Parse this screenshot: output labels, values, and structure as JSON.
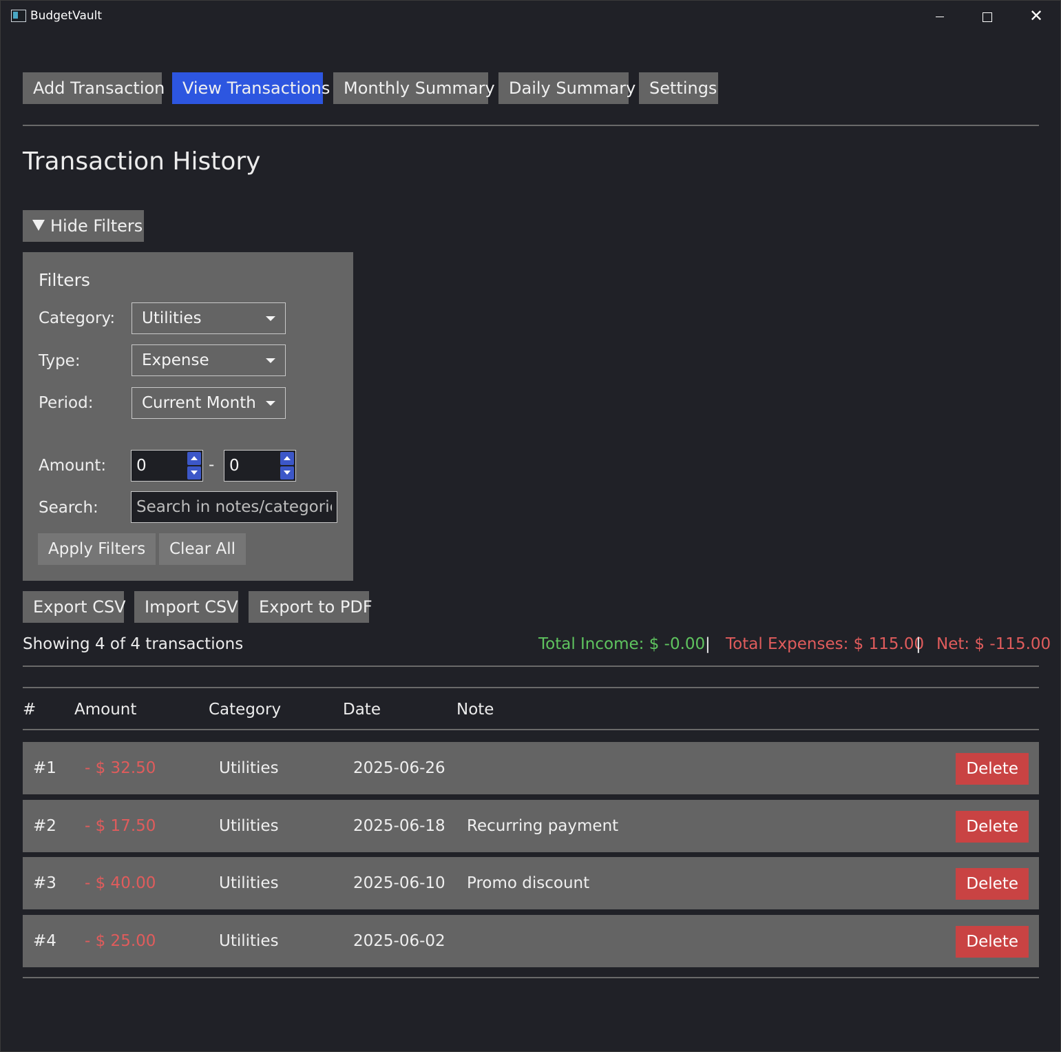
{
  "window": {
    "title": "BudgetVault",
    "icon": "app-icon"
  },
  "nav": {
    "tabs": [
      {
        "label": "Add Transaction",
        "active": false
      },
      {
        "label": "View Transactions",
        "active": true
      },
      {
        "label": "Monthly Summary",
        "active": false
      },
      {
        "label": "Daily Summary",
        "active": false
      },
      {
        "label": "Settings",
        "active": false
      }
    ]
  },
  "page": {
    "title": "Transaction History",
    "toggle_filters_icon": "triangle-down-icon",
    "toggle_filters_label": "Hide Filters"
  },
  "filters": {
    "heading": "Filters",
    "category_label": "Category:",
    "category_value": "Utilities",
    "type_label": "Type:",
    "type_value": "Expense",
    "period_label": "Period:",
    "period_value": "Current Month",
    "amount_label": "Amount:",
    "amount_min": "0",
    "amount_separator": "-",
    "amount_max": "0",
    "search_label": "Search:",
    "search_placeholder": "Search in notes/categories",
    "apply_label": "Apply Filters",
    "clear_label": "Clear All"
  },
  "actions": {
    "export_csv": "Export CSV",
    "import_csv": "Import CSV",
    "export_pdf": "Export to PDF"
  },
  "summary": {
    "showing": "Showing 4 of 4 transactions",
    "total_income": "Total Income: $ -0.00",
    "separator": "|",
    "total_expenses": "Total Expenses: $ 115.00",
    "net": "Net: $ -115.00"
  },
  "table": {
    "columns": [
      "#",
      "Amount",
      "Category",
      "Date",
      "Note"
    ],
    "rows": [
      {
        "id": "#1",
        "amount": "- $ 32.50",
        "category": "Utilities",
        "date": "2025-06-26",
        "note": "",
        "action": "Delete"
      },
      {
        "id": "#2",
        "amount": "- $ 17.50",
        "category": "Utilities",
        "date": "2025-06-18",
        "note": "Recurring payment",
        "action": "Delete"
      },
      {
        "id": "#3",
        "amount": "- $ 40.00",
        "category": "Utilities",
        "date": "2025-06-10",
        "note": "Promo discount",
        "action": "Delete"
      },
      {
        "id": "#4",
        "amount": "- $ 25.00",
        "category": "Utilities",
        "date": "2025-06-02",
        "note": "",
        "action": "Delete"
      }
    ]
  },
  "colors": {
    "background": "#202127",
    "active_tab": "#2d56e0",
    "income": "#5fc45f",
    "expense": "#e05c5c",
    "delete_button": "#c94343"
  }
}
